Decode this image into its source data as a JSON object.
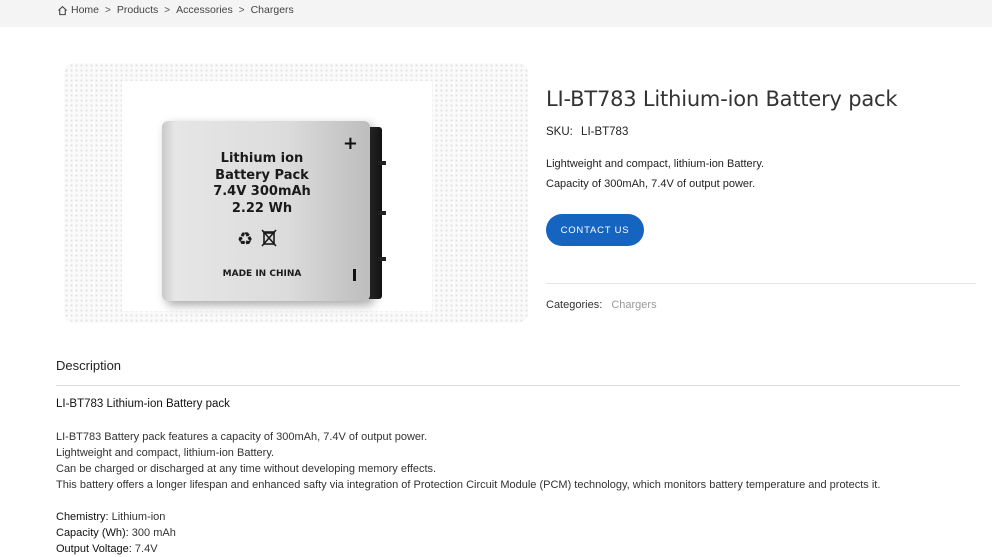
{
  "breadcrumb": {
    "items": [
      "Home",
      "Products",
      "Accessories",
      "Chargers"
    ],
    "separator": ">"
  },
  "product_image": {
    "label_lines": [
      "Lithium ion",
      "Battery Pack",
      "7.4V 300mAh",
      "2.22 Wh"
    ],
    "made_in": "MADE IN CHINA",
    "plus_sign": "+",
    "icons": [
      "recycle-icon",
      "weee-bin-icon"
    ]
  },
  "product": {
    "title": "LI-BT783 Lithium-ion Battery pack",
    "sku_label": "SKU:",
    "sku_value": "LI-BT783",
    "short_description": [
      "Lightweight and compact, lithium-ion Battery.",
      "Capacity of 300mAh, 7.4V of output power."
    ],
    "contact_button": "CONTACT US",
    "categories_label": "Categories:",
    "category": "Chargers"
  },
  "description": {
    "tab_label": "Description",
    "heading": "LI-BT783 Lithium-ion Battery pack",
    "paragraphs": [
      "LI-BT783 Battery pack features a capacity of 300mAh, 7.4V of output power.",
      "Lightweight and compact, lithium-ion Battery.",
      "Can be charged or discharged at any time without developing memory effects.",
      "This battery offers a longer lifespan and enhanced safty via integration of Protection Circuit Module (PCM) technology, which monitors battery temperature and protects it."
    ],
    "specs": [
      {
        "label": "Chemistry:",
        "value": " Lithium-ion"
      },
      {
        "label": "Capacity (Wh):",
        "value": " 300 mAh"
      },
      {
        "label": "Output Voltage:",
        "value": " 7.4V"
      }
    ]
  },
  "colors": {
    "accent": "#1565c0",
    "topbar": "#f4f4f4",
    "category_link": "#999999"
  }
}
